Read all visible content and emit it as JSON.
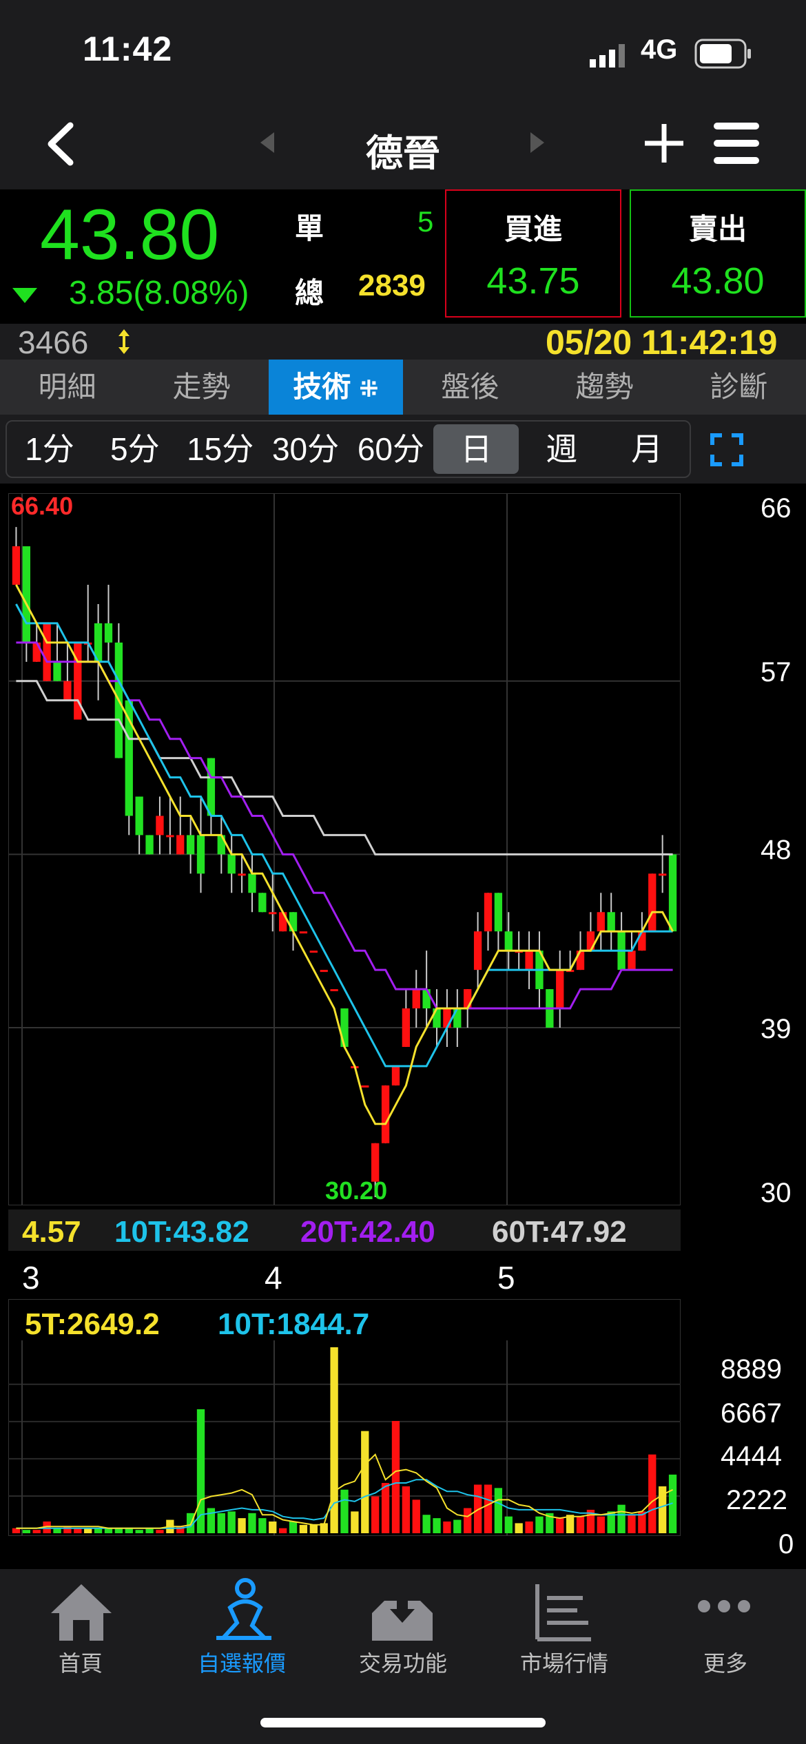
{
  "status": {
    "time": "11:42",
    "network": "4G"
  },
  "nav": {
    "title": "德晉"
  },
  "quote": {
    "price": "43.80",
    "change": "3.85(8.08%)",
    "single_label": "單",
    "single_value": "5",
    "total_label": "總",
    "total_value": "2839",
    "buy_label": "買進",
    "buy_value": "43.75",
    "sell_label": "賣出",
    "sell_value": "43.80",
    "code": "3466",
    "datetime": "05/20 11:42:19"
  },
  "tabs": [
    "明細",
    "走勢",
    "技術",
    "盤後",
    "趨勢",
    "診斷"
  ],
  "periods": [
    "1分",
    "5分",
    "15分",
    "30分",
    "60分",
    "日",
    "週",
    "月"
  ],
  "colors": {
    "up": "#ff1010",
    "down": "#22e122",
    "ma5": "#f5e12c",
    "ma10": "#1ec3ea",
    "ma20": "#a21ff0",
    "ma60": "#d0d0d0",
    "accent": "#0a84d8"
  },
  "chart_data": [
    {
      "type": "candlestick",
      "y_ticks": [
        "66",
        "57",
        "48",
        "39",
        "30"
      ],
      "ylim": [
        30.2,
        66.4
      ],
      "max_label": "66.40",
      "min_label": "30.20",
      "x_ticks": [
        "3",
        "4",
        "5"
      ],
      "ma_labels": {
        "ma5": "4.57",
        "ma10": "10T:43.82",
        "ma20": "20T:42.40",
        "ma60": "60T:47.92"
      },
      "candles": [
        [
          62,
          64,
          65,
          63
        ],
        [
          64,
          59,
          61,
          58
        ],
        [
          58,
          59,
          60,
          58
        ],
        [
          57,
          60,
          60,
          57
        ],
        [
          58,
          57,
          60,
          57
        ],
        [
          56,
          57,
          59,
          56
        ],
        [
          55,
          59,
          59,
          57
        ],
        [
          59,
          59,
          62,
          58
        ],
        [
          60,
          58,
          61,
          56
        ],
        [
          60,
          59,
          62,
          58
        ],
        [
          59,
          53,
          60,
          53
        ],
        [
          56,
          50,
          56,
          49
        ],
        [
          51,
          49,
          51,
          48
        ],
        [
          49,
          48,
          49,
          48
        ],
        [
          49,
          50,
          51,
          48
        ],
        [
          49,
          49,
          51,
          48
        ],
        [
          48,
          49,
          51,
          48
        ],
        [
          49,
          48,
          50,
          47
        ],
        [
          49,
          47,
          51,
          46
        ],
        [
          53,
          50,
          53,
          49
        ],
        [
          49,
          48,
          50,
          47
        ],
        [
          48,
          47,
          49,
          46
        ],
        [
          47,
          47,
          48,
          46
        ],
        [
          47,
          46,
          48,
          45
        ],
        [
          46,
          45,
          46,
          45
        ],
        [
          45,
          45,
          47,
          44
        ],
        [
          44,
          45,
          45,
          44
        ],
        [
          45,
          44,
          45,
          43
        ],
        [
          44,
          44,
          44,
          44
        ],
        [
          43,
          43,
          43,
          43
        ],
        [
          42,
          42,
          42,
          42
        ],
        [
          41,
          41,
          41,
          41
        ],
        [
          40,
          38,
          40,
          38
        ],
        [
          37,
          37,
          37,
          37
        ],
        [
          36,
          36,
          36,
          36
        ],
        [
          31,
          33,
          33,
          30.2
        ],
        [
          33,
          36,
          36,
          33
        ],
        [
          36,
          37,
          37,
          36
        ],
        [
          38,
          40,
          41,
          38
        ],
        [
          40,
          41,
          42,
          39
        ],
        [
          41,
          40,
          43,
          39
        ],
        [
          40,
          39,
          41,
          38
        ],
        [
          39,
          40,
          41,
          38
        ],
        [
          40,
          39,
          41,
          38
        ],
        [
          40,
          41,
          41,
          39
        ],
        [
          42,
          44,
          45,
          41
        ],
        [
          44,
          46,
          46,
          43
        ],
        [
          46,
          44,
          46,
          43
        ],
        [
          44,
          43,
          45,
          42
        ],
        [
          43,
          43,
          44,
          42
        ],
        [
          42,
          43,
          44,
          41
        ],
        [
          43,
          41,
          44,
          40
        ],
        [
          41,
          39,
          41,
          39
        ],
        [
          40,
          42,
          43,
          39
        ],
        [
          42,
          42,
          43,
          42
        ],
        [
          42,
          43,
          44,
          42
        ],
        [
          43,
          44,
          45,
          43
        ],
        [
          44,
          45,
          46,
          43
        ],
        [
          45,
          44,
          46,
          43
        ],
        [
          44,
          42,
          45,
          42
        ],
        [
          42,
          43,
          44,
          42
        ],
        [
          43,
          44,
          45,
          43
        ],
        [
          44,
          47,
          47,
          44
        ],
        [
          47,
          47,
          49,
          46
        ],
        [
          48,
          44,
          48,
          44
        ]
      ],
      "ma5": [
        62,
        61,
        60,
        59,
        59,
        59,
        58,
        58,
        58,
        57,
        56,
        55,
        54,
        53,
        52,
        51,
        50,
        50,
        49,
        49,
        49,
        48,
        48,
        47,
        47,
        46,
        45,
        44,
        43,
        42,
        41,
        40,
        38,
        37,
        35,
        34,
        34,
        35,
        36,
        38,
        39,
        40,
        40,
        40,
        40,
        41,
        42,
        43,
        43,
        43,
        43,
        43,
        42,
        42,
        42,
        43,
        43,
        44,
        44,
        44,
        44,
        44,
        45,
        45,
        44
      ],
      "ma10": [
        61,
        60,
        60,
        60,
        60,
        59,
        59,
        59,
        58,
        58,
        57,
        56,
        55,
        54,
        53,
        52,
        52,
        51,
        51,
        50,
        50,
        49,
        49,
        48,
        48,
        47,
        47,
        46,
        45,
        44,
        43,
        42,
        41,
        40,
        39,
        38,
        37,
        37,
        37,
        37,
        37,
        38,
        39,
        40,
        40,
        41,
        42,
        42,
        42,
        42,
        42,
        42,
        42,
        42,
        42,
        43,
        43,
        43,
        43,
        43,
        43,
        44,
        44,
        44,
        44
      ],
      "ma20": [
        59,
        59,
        59,
        58,
        58,
        58,
        58,
        58,
        58,
        57,
        57,
        56,
        56,
        55,
        55,
        54,
        54,
        53,
        53,
        52,
        52,
        51,
        51,
        50,
        50,
        49,
        48,
        48,
        47,
        46,
        46,
        45,
        44,
        43,
        43,
        42,
        42,
        41,
        41,
        41,
        41,
        40,
        40,
        40,
        40,
        40,
        40,
        40,
        40,
        40,
        40,
        40,
        40,
        40,
        40,
        41,
        41,
        41,
        41,
        42,
        42,
        42,
        42,
        42,
        42
      ],
      "ma60": [
        57,
        57,
        57,
        56,
        56,
        56,
        56,
        55,
        55,
        55,
        55,
        54,
        54,
        54,
        53,
        53,
        53,
        53,
        52,
        52,
        52,
        52,
        51,
        51,
        51,
        51,
        50,
        50,
        50,
        50,
        49,
        49,
        49,
        49,
        49,
        48,
        48,
        48,
        48,
        48,
        48,
        48,
        48,
        48,
        48,
        48,
        48,
        48,
        48,
        48,
        48,
        48,
        48,
        48,
        48,
        48,
        48,
        48,
        48,
        48,
        48,
        48,
        48,
        48,
        48
      ]
    },
    {
      "type": "bar",
      "y_ticks": [
        "8889",
        "6667",
        "4444",
        "2222",
        "0"
      ],
      "ylim": [
        0,
        11100
      ],
      "ma_labels": {
        "ma5": "5T:2649.2",
        "ma10": "10T:1844.7"
      },
      "volumes": [
        300,
        200,
        200,
        700,
        300,
        400,
        300,
        300,
        300,
        300,
        300,
        300,
        200,
        300,
        200,
        800,
        400,
        1200,
        7400,
        1500,
        1200,
        1300,
        900,
        1200,
        900,
        700,
        300,
        700,
        500,
        500,
        600,
        11100,
        2600,
        1300,
        6100,
        2200,
        3000,
        6700,
        2800,
        2000,
        1100,
        900,
        700,
        800,
        1500,
        2900,
        2900,
        2700,
        1000,
        600,
        700,
        1000,
        1200,
        900,
        1100,
        1000,
        1400,
        1000,
        1300,
        1700,
        1100,
        1300,
        4700,
        2800,
        3500
      ],
      "ma5": [
        300,
        300,
        300,
        400,
        400,
        400,
        400,
        400,
        400,
        300,
        300,
        300,
        300,
        300,
        300,
        400,
        400,
        500,
        2000,
        2200,
        2300,
        2400,
        2600,
        2300,
        1100,
        1100,
        800,
        700,
        600,
        500,
        500,
        2500,
        2900,
        3100,
        4100,
        4700,
        3200,
        3700,
        3800,
        3600,
        3100,
        2700,
        1500,
        1100,
        1000,
        1400,
        1700,
        2000,
        2000,
        1700,
        1600,
        1200,
        1000,
        900,
        1000,
        1000,
        1100,
        1100,
        1200,
        1300,
        1200,
        1300,
        1900,
        2300,
        2600
      ],
      "ma10": [
        300,
        300,
        300,
        300,
        300,
        300,
        300,
        300,
        300,
        300,
        300,
        300,
        300,
        300,
        300,
        300,
        300,
        400,
        1100,
        1200,
        1300,
        1400,
        1500,
        1400,
        1400,
        1300,
        1000,
        900,
        900,
        800,
        900,
        1800,
        2000,
        1900,
        2200,
        2400,
        2800,
        3000,
        3000,
        3200,
        3200,
        2800,
        2500,
        2500,
        2300,
        2200,
        2000,
        1800,
        1500,
        1400,
        1400,
        1400,
        1400,
        1400,
        1300,
        1200,
        1200,
        1100,
        1100,
        1100,
        1100,
        1100,
        1400,
        1600,
        1800
      ]
    }
  ],
  "tabbar": [
    {
      "label": "首頁",
      "icon": "home-icon"
    },
    {
      "label": "自選報價",
      "icon": "watchlist-icon"
    },
    {
      "label": "交易功能",
      "icon": "trade-icon"
    },
    {
      "label": "市場行情",
      "icon": "market-icon"
    },
    {
      "label": "更多",
      "icon": "more-icon"
    }
  ]
}
